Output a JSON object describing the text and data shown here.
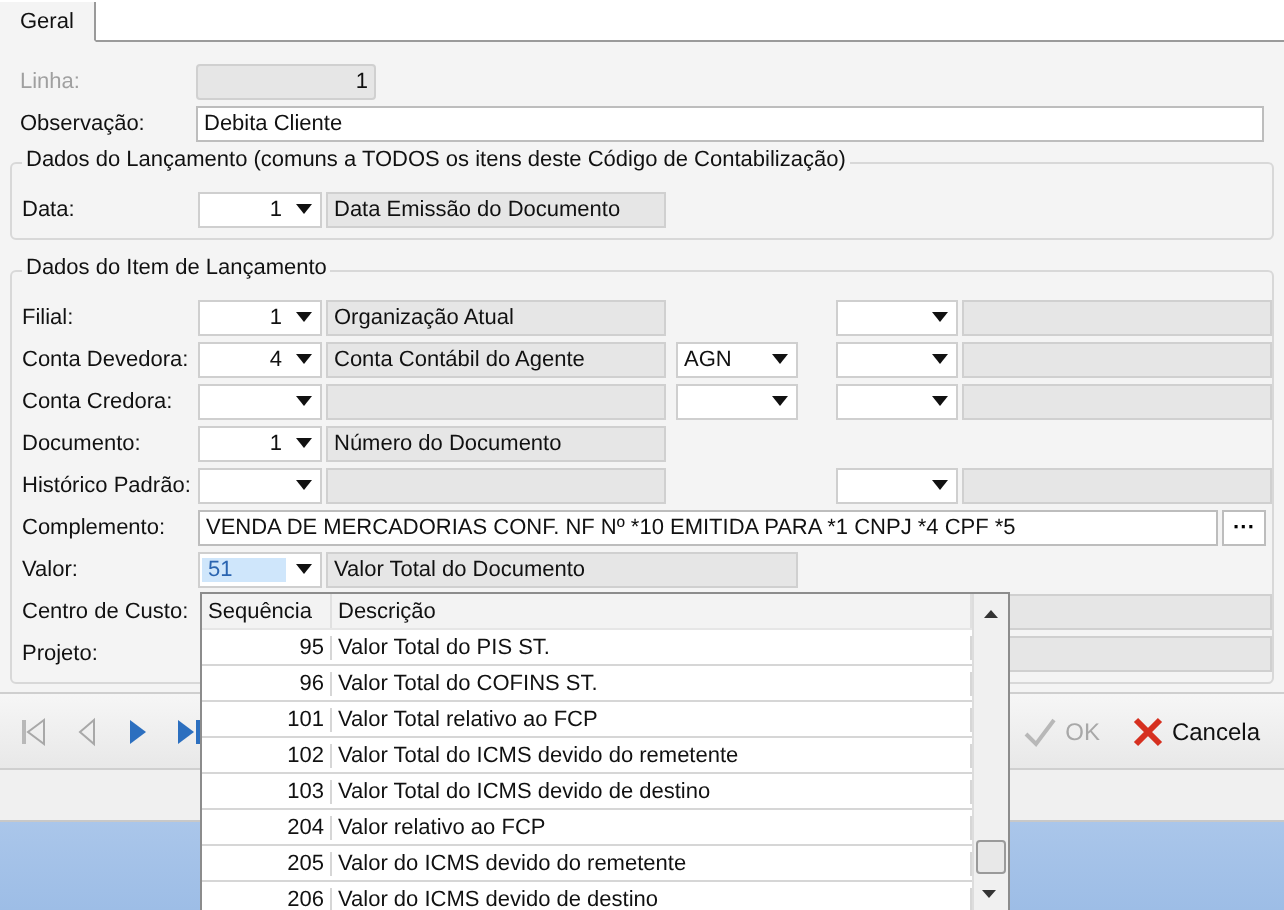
{
  "tabs": [
    {
      "label": "Geral",
      "selected": true
    }
  ],
  "linha": {
    "label": "Linha:",
    "value": "1",
    "disabled": true
  },
  "observacao": {
    "label": "Observação:",
    "value": "Debita Cliente"
  },
  "lancamento": {
    "title": "Dados do Lançamento (comuns a TODOS os itens deste Código de Contabilização)",
    "rows": [
      {
        "kind": "lookup",
        "label": "Data:",
        "code": "1",
        "description": "Data Emissão do Documento",
        "account_combo": false,
        "extra_lookup": false
      }
    ]
  },
  "item": {
    "title": "Dados do Item de Lançamento",
    "rows": [
      {
        "kind": "lookup",
        "label": "Filial:",
        "code": "1",
        "description": "Organização Atual",
        "account_combo": false,
        "extra_lookup": true
      },
      {
        "kind": "lookup",
        "label": "Conta Devedora:",
        "code": "4",
        "description": "Conta Contábil do Agente",
        "account_combo": true,
        "account": "AGN",
        "extra_lookup": true
      },
      {
        "kind": "lookup",
        "label": "Conta Credora:",
        "account_combo": true,
        "extra_lookup": true
      },
      {
        "kind": "lookup",
        "label": "Documento:",
        "code": "1",
        "description": "Número do Documento",
        "account_combo": false,
        "extra_lookup": false
      },
      {
        "kind": "lookup",
        "label": "Histórico Padrão:",
        "account_combo": false,
        "extra_lookup": true
      },
      {
        "kind": "text",
        "label": "Complemento:",
        "value": "VENDA DE MERCADORIAS CONF. NF Nº *10 EMITIDA PARA *1 CNPJ *4 CPF *5",
        "button": "···"
      },
      {
        "kind": "lookup_wide",
        "label": "Valor:",
        "code": "51",
        "code_selected": true,
        "description": "Valor Total do Documento"
      },
      {
        "kind": "covered",
        "label": "Centro de Custo:"
      },
      {
        "kind": "covered",
        "label": "Projeto:"
      }
    ]
  },
  "dropdown": {
    "columns": [
      "Sequência",
      "Descrição"
    ],
    "rows": [
      {
        "seq": "95",
        "desc": "Valor Total do PIS ST."
      },
      {
        "seq": "96",
        "desc": "Valor Total do COFINS ST."
      },
      {
        "seq": "101",
        "desc": "Valor Total relativo ao FCP"
      },
      {
        "seq": "102",
        "desc": "Valor Total do ICMS devido do remetente"
      },
      {
        "seq": "103",
        "desc": "Valor Total do ICMS devido de destino"
      },
      {
        "seq": "204",
        "desc": "Valor relativo ao FCP"
      },
      {
        "seq": "205",
        "desc": "Valor do ICMS devido do remetente"
      },
      {
        "seq": "206",
        "desc": "Valor do ICMS devido de destino"
      }
    ]
  },
  "toolbar": {
    "ok": {
      "label": "OK",
      "disabled": true
    },
    "cancel": {
      "label": "Cancela",
      "disabled": false
    }
  }
}
